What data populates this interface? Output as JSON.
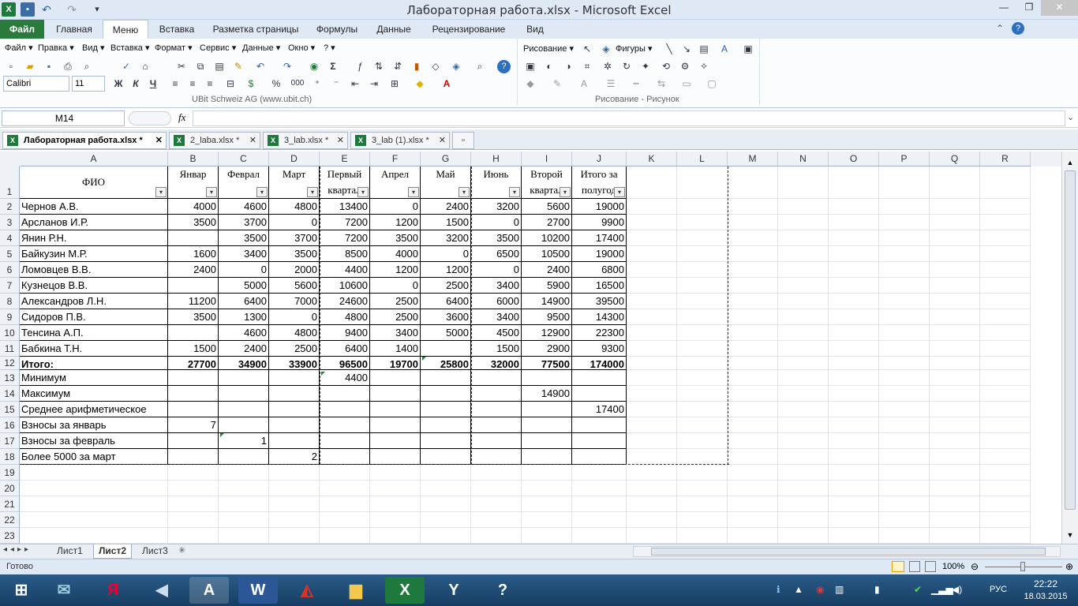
{
  "window": {
    "title": "Лабораторная работа.xlsx - Microsoft Excel",
    "min": "—",
    "max": "❐",
    "close": "✕"
  },
  "ribbon_tabs": [
    "Файл",
    "Главная",
    "Меню",
    "Вставка",
    "Разметка страницы",
    "Формулы",
    "Данные",
    "Рецензирование",
    "Вид"
  ],
  "classic_menu": [
    "Файл ▾",
    "Правка ▾",
    "Вид ▾",
    "Вставка ▾",
    "Формат ▾",
    "Сервис ▾",
    "Данные ▾",
    "Окно ▾",
    "? ▾"
  ],
  "toolbar": {
    "font": "Calibri",
    "size": "11",
    "bold": "Ж",
    "italic": "К",
    "underline": "Ч",
    "percent": "%",
    "thousands": "000",
    "ubit": "UBit Schweiz AG    (www.ubit.ch)",
    "drawing": "Рисование ▾",
    "shapes": "Фигуры ▾",
    "drawing_group": "Рисование - Рисунок"
  },
  "formula_bar": {
    "name_box": "M14",
    "fx": "fx",
    "formula": ""
  },
  "workbook_tabs": [
    "Лабораторная работа.xlsx *",
    "2_laba.xlsx *",
    "3_lab.xlsx *",
    "3_lab (1).xlsx *"
  ],
  "columns": [
    "A",
    "B",
    "C",
    "D",
    "E",
    "F",
    "G",
    "H",
    "I",
    "J",
    "K",
    "L",
    "M",
    "N",
    "O",
    "P",
    "Q",
    "R"
  ],
  "headers": [
    "ФИО",
    "Январ",
    "Феврал",
    "Март",
    "Первый квартал",
    "Апрел",
    "Май",
    "Июнь",
    "Второй квартал",
    "Итого за полугод"
  ],
  "rows": [
    [
      "Чернов А.В.",
      "4000",
      "4600",
      "4800",
      "13400",
      "0",
      "2400",
      "3200",
      "5600",
      "19000"
    ],
    [
      "Арсланов И.Р.",
      "3500",
      "3700",
      "0",
      "7200",
      "1200",
      "1500",
      "0",
      "2700",
      "9900"
    ],
    [
      "Янин Р.Н.",
      "",
      "3500",
      "3700",
      "7200",
      "3500",
      "3200",
      "3500",
      "10200",
      "17400"
    ],
    [
      "Байкузин М.Р.",
      "1600",
      "3400",
      "3500",
      "8500",
      "4000",
      "0",
      "6500",
      "10500",
      "19000"
    ],
    [
      "Ломовцев В.В.",
      "2400",
      "0",
      "2000",
      "4400",
      "1200",
      "1200",
      "0",
      "2400",
      "6800"
    ],
    [
      "Кузнецов В.В.",
      "",
      "5000",
      "5600",
      "10600",
      "0",
      "2500",
      "3400",
      "5900",
      "16500"
    ],
    [
      "Александров Л.Н.",
      "11200",
      "6400",
      "7000",
      "24600",
      "2500",
      "6400",
      "6000",
      "14900",
      "39500"
    ],
    [
      "Сидоров П.В.",
      "3500",
      "1300",
      "0",
      "4800",
      "2500",
      "3600",
      "3400",
      "9500",
      "14300"
    ],
    [
      "Тенсина А.П.",
      "",
      "4600",
      "4800",
      "9400",
      "3400",
      "5000",
      "4500",
      "12900",
      "22300"
    ],
    [
      "Бабкина Т.Н.",
      "1500",
      "2400",
      "2500",
      "6400",
      "1400",
      "",
      "1500",
      "2900",
      "9300"
    ],
    [
      "Итого:",
      "27700",
      "34900",
      "33900",
      "96500",
      "19700",
      "25800",
      "32000",
      "77500",
      "174000"
    ],
    [
      "Минимум",
      "",
      "",
      "",
      "4400",
      "",
      "",
      "",
      "",
      ""
    ],
    [
      "Максимум",
      "",
      "",
      "",
      "",
      "",
      "",
      "",
      "14900",
      ""
    ],
    [
      "Среднее  арифметическое",
      "",
      "",
      "",
      "",
      "",
      "",
      "",
      "",
      "17400"
    ],
    [
      "Взносы за январь",
      "7",
      "",
      "",
      "",
      "",
      "",
      "",
      "",
      ""
    ],
    [
      "Взносы за февраль",
      "",
      "1",
      "",
      "",
      "",
      "",
      "",
      "",
      ""
    ],
    [
      "Более 5000 за март",
      "",
      "",
      "2",
      "",
      "",
      "",
      "",
      "",
      ""
    ]
  ],
  "row_numbers": [
    "1",
    "2",
    "3",
    "4",
    "5",
    "6",
    "7",
    "8",
    "9",
    "10",
    "11",
    "12",
    "13",
    "14",
    "15",
    "16",
    "17",
    "18",
    "19",
    "20",
    "21",
    "22",
    "23"
  ],
  "sheets": [
    "Лист1",
    "Лист2",
    "Лист3"
  ],
  "status": {
    "ready": "Готово",
    "zoom": "100%"
  },
  "tray": {
    "lang": "РУС",
    "time": "22:22",
    "date": "18.03.2015"
  }
}
